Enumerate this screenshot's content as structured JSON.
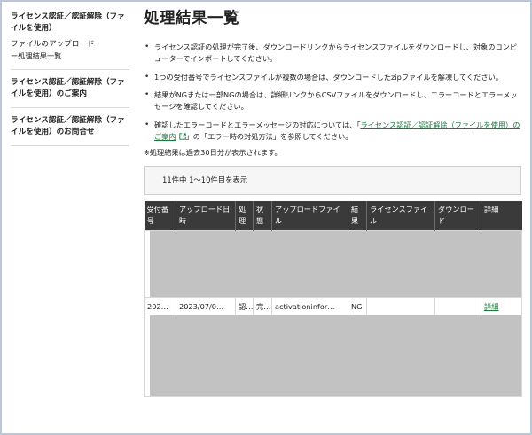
{
  "sidebar": {
    "section1_title": "ライセンス認証／認証解除（ファイルを使用）",
    "section1_sub": "ファイルのアップロード",
    "section1_sub2": "ー処理結果一覧",
    "section2_link": "ライセンス認証／認証解除（ファイルを使用）のご案内",
    "section3_link": "ライセンス認証／認証解除（ファイルを使用）のお問合せ"
  },
  "main": {
    "title": "処理結果一覧",
    "notes": [
      "ライセンス認証の処理が完了後、ダウンロードリンクからライセンスファイルをダウンロードし、対象のコンピューターでインポートしてください。",
      "1つの受付番号でライセンスファイルが複数の場合は、ダウンロードしたzipファイルを解凍してください。",
      "結果がNGまたは一部NGの場合は、詳細リンクからCSVファイルをダウンロードし、エラーコードとエラーメッセージを確認してください。"
    ],
    "note4_prefix": "確認したエラーコードとエラーメッセージの対応については、「",
    "note4_link": "ライセンス認証／認証解除（ファイルを使用）のご案内",
    "note4_suffix": "」の「エラー時の対処方法」を参照してください。",
    "retain_note": "※処理結果は過去30日分が表示されます。",
    "count_text": "11件中 1〜10件目を表示"
  },
  "table": {
    "headers": [
      "受付番号",
      "アップロード日時",
      "処理",
      "状態",
      "アップロードファイル",
      "結果",
      "ライセンスファイル",
      "ダウンロード",
      "詳細"
    ],
    "row": {
      "receipt": "202…",
      "upload_date": "2023/07/0…",
      "process": "認…",
      "status": "完…",
      "file": "activationinfor…",
      "result": "NG",
      "license_file": "",
      "download": "",
      "detail": "詳細"
    }
  },
  "colors": {
    "accent_link": "#1a7a3a",
    "header_bg": "#3a3a3a",
    "redaction": "#c2c2c2",
    "frame": "#b9c7d8"
  }
}
